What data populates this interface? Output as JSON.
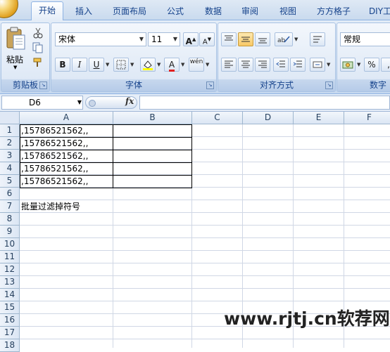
{
  "tabs": [
    "开始",
    "插入",
    "页面布局",
    "公式",
    "数据",
    "审阅",
    "视图",
    "方方格子",
    "DIY工"
  ],
  "ribbon": {
    "clipboard": {
      "label": "剪贴板",
      "paste_label": "粘贴"
    },
    "font": {
      "label": "字体",
      "font_name": "宋体",
      "font_size": "11",
      "bold": "B",
      "italic": "I",
      "underline": "U",
      "grow": "A",
      "shrink": "A",
      "font_color": "A",
      "phonetic": "wén"
    },
    "alignment": {
      "label": "对齐方式"
    },
    "number": {
      "label": "数字",
      "format": "常规",
      "percent": "%"
    }
  },
  "formula_bar": {
    "name_box": "D6",
    "fx": "fx",
    "formula": ""
  },
  "columns": [
    "A",
    "B",
    "C",
    "D",
    "E",
    "F"
  ],
  "rows": [
    "1",
    "2",
    "3",
    "4",
    "5",
    "6",
    "7",
    "8",
    "9",
    "10",
    "11",
    "12",
    "13",
    "14",
    "15",
    "16",
    "17",
    "18"
  ],
  "cells": {
    "A1": ",15786521562,,",
    "A2": ",15786521562,,",
    "A3": ",15786521562,,",
    "A4": ",15786521562,,",
    "A5": ",15786521562,,",
    "A7": "批量过滤掉符号"
  },
  "watermark": "www.rjtj.cn软荐网"
}
